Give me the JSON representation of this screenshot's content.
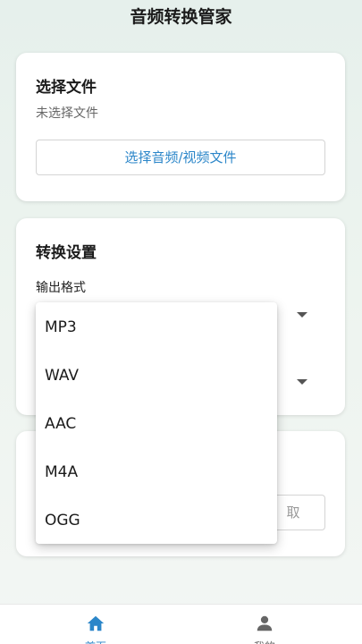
{
  "app": {
    "title": "音频转换管家"
  },
  "file_card": {
    "heading": "选择文件",
    "status": "未选择文件",
    "pick_button": "选择音频/视频文件"
  },
  "settings_card": {
    "heading": "转换设置",
    "output_format_label": "输出格式"
  },
  "third_card": {
    "cancel_button_partial": "取"
  },
  "format_dropdown": {
    "options": [
      "MP3",
      "WAV",
      "AAC",
      "M4A",
      "OGG"
    ]
  },
  "bottom_nav": {
    "items": [
      {
        "label": "首页",
        "icon": "home-icon",
        "active": true
      },
      {
        "label": "我的",
        "icon": "person-icon",
        "active": false
      }
    ],
    "active_color": "#2b86c9"
  }
}
